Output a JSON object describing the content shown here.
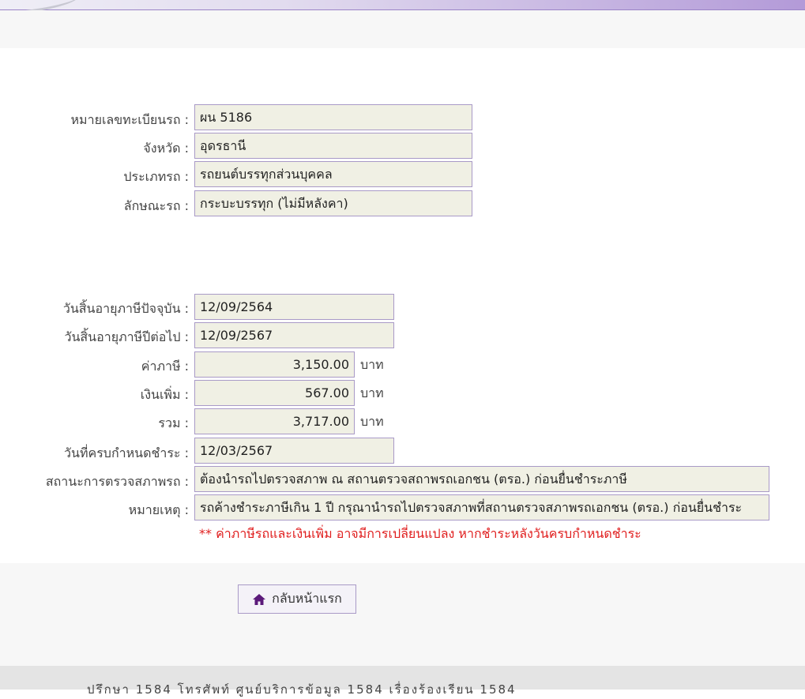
{
  "vehicle": {
    "plate_label": "หมายเลขทะเบียนรถ :",
    "plate_value": "ผน 5186",
    "province_label": "จังหวัด :",
    "province_value": "อุดรธานี",
    "type_label": "ประเภทรถ :",
    "type_value": "รถยนต์บรรทุกส่วนบุคคล",
    "body_label": "ลักษณะรถ :",
    "body_value": "กระบะบรรทุก (ไม่มีหลังคา)"
  },
  "tax": {
    "current_expiry_label": "วันสิ้นอายุภาษีปัจจุบัน :",
    "current_expiry_value": "12/09/2564",
    "next_expiry_label": "วันสิ้นอายุภาษีปีต่อไป :",
    "next_expiry_value": "12/09/2567",
    "tax_label": "ค่าภาษี :",
    "tax_value": "3,150.00",
    "surcharge_label": "เงินเพิ่ม :",
    "surcharge_value": "567.00",
    "total_label": "รวม :",
    "total_value": "3,717.00",
    "unit": "บาท",
    "due_label": "วันที่ครบกำหนดชำระ :",
    "due_value": "12/03/2567",
    "inspection_label": "สถานะการตรวจสภาพรถ :",
    "inspection_value": "ต้องนำรถไปตรวจสภาพ ณ สถานตรวจสถาพรถเอกชน (ตรอ.) ก่อนยื่นชำระภาษี",
    "remark_label": "หมายเหตุ :",
    "remark_value": "รถค้างชำระภาษีเกิน 1 ปี กรุณานำรถไปตรวจสภาพที่สถานตรวจสภาพรถเอกชน (ตรอ.) ก่อนยื่นชำระ",
    "warning": "** ค่าภาษีรถและเงินเพิ่ม อาจมีการเปลี่ยนแปลง หากชำระหลังวันครบกำหนดชำระ"
  },
  "actions": {
    "home_label": "กลับหน้าแรก",
    "home_icon": "home-icon"
  },
  "footer": {
    "text": "ปรึกษา 1584 โทรศัพท์ ศูนย์บริการข้อมูล 1584 เรื่องร้องเรียน 1584"
  }
}
